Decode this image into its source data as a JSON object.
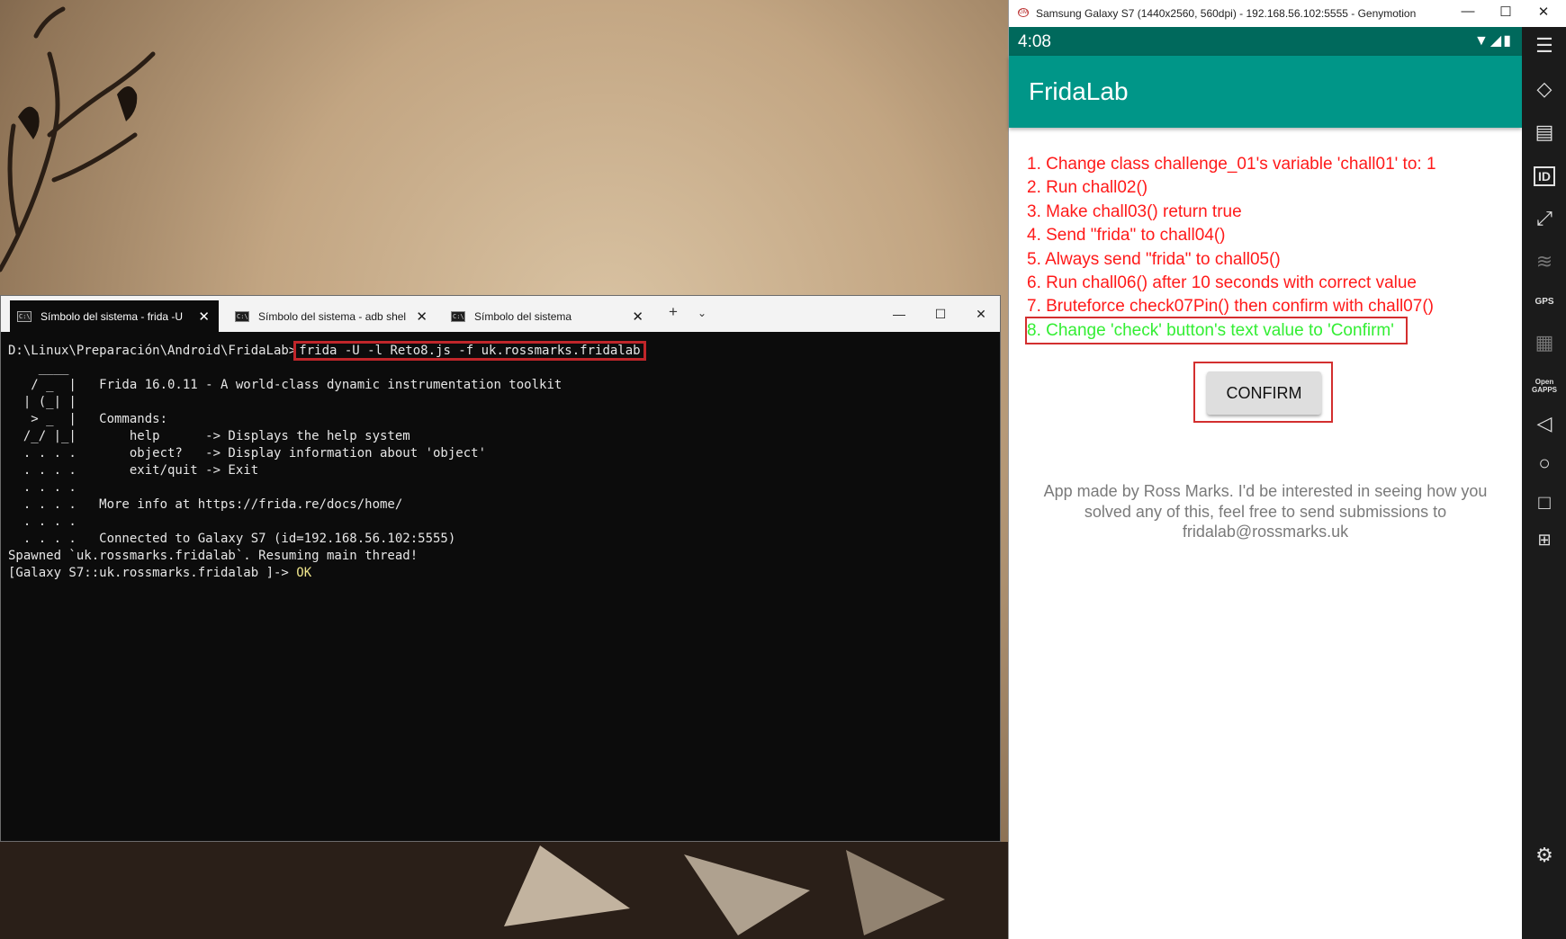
{
  "terminal": {
    "tabs": [
      {
        "label": "Símbolo del sistema - frida -U",
        "icon": "cmd-icon"
      },
      {
        "label": "Símbolo del sistema - adb shel",
        "icon": "cmd-icon"
      },
      {
        "label": "Símbolo del sistema",
        "icon": "cmd-icon"
      }
    ],
    "prompt": "D:\\Linux\\Preparación\\Android\\FridaLab>",
    "command": "frida -U -l Reto8.js -f uk.rossmarks.fridalab",
    "banner": [
      "    ____",
      "   / _  |   Frida 16.0.11 - A world-class dynamic instrumentation toolkit",
      "  | (_| |",
      "   > _  |   Commands:",
      "  /_/ |_|       help      -> Displays the help system",
      "  . . . .       object?   -> Display information about 'object'",
      "  . . . .       exit/quit -> Exit",
      "  . . . .",
      "  . . . .   More info at https://frida.re/docs/home/",
      "  . . . .",
      "  . . . .   Connected to Galaxy S7 (id=192.168.56.102:5555)",
      "Spawned `uk.rossmarks.fridalab`. Resuming main thread!"
    ],
    "repl_prompt": "[Galaxy S7::uk.rossmarks.fridalab ]-> ",
    "repl_output": "OK"
  },
  "emulator": {
    "window_title": "Samsung Galaxy S7 (1440x2560, 560dpi) - 192.168.56.102:5555 - Genymotion",
    "status_time": "4:08",
    "app_title": "FridaLab",
    "challenges": [
      "1. Change class challenge_01's variable 'chall01' to: 1",
      "2. Run chall02()",
      "3. Make chall03() return true",
      "4. Send \"frida\" to chall04()",
      "5. Always send \"frida\" to chall05()",
      "6. Run chall06() after 10 seconds with correct value",
      "7. Bruteforce check07Pin() then confirm with chall07()",
      "8. Change 'check' button's text value to 'Confirm'"
    ],
    "completed_challenge_index": 7,
    "confirm_button": "CONFIRM",
    "footer": "App made by Ross Marks. I'd be interested in seeing how you solved any of this, feel free to send submissions to fridalab@rossmarks.uk",
    "toolbar": {
      "id_label": "ID",
      "gps_label": "GPS",
      "opengapps_label": "Open GAPPS"
    }
  },
  "colors": {
    "challenge_pending": "#ff1a1a",
    "challenge_done": "#33ee33",
    "app_bar": "#009688",
    "status_bar": "#00695c",
    "highlight_box": "#c0262a"
  }
}
